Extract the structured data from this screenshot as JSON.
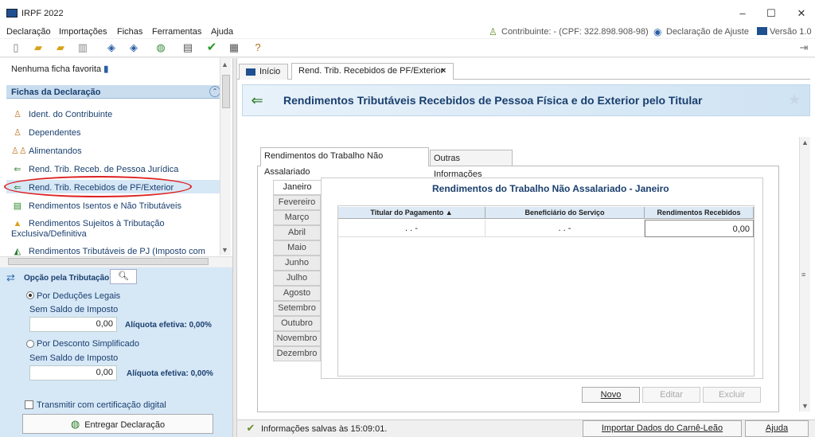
{
  "window": {
    "title": "IRPF 2022"
  },
  "menu": [
    "Declaração",
    "Importações",
    "Fichas",
    "Ferramentas",
    "Ajuda"
  ],
  "status_right": {
    "contribuinte": "Contribuinte: - (CPF: 322.898.908-98)",
    "declaracao": "Declaração de Ajuste",
    "versao": "Versão 1.0"
  },
  "sidebar": {
    "favorites": "Nenhuma ficha favorita",
    "header": "Fichas da Declaração",
    "items": [
      "Ident. do Contribuinte",
      "Dependentes",
      "Alimentandos",
      "Rend. Trib. Receb. de Pessoa Jurídica",
      "Rend. Trib. Recebidos de PF/Exterior",
      "Rendimentos Isentos e Não Tributáveis",
      "Rendimentos Sujeitos à Tributação",
      "Exclusiva/Definitiva",
      "Rendimentos Tributáveis de PJ (Imposto com"
    ]
  },
  "opcao": {
    "title": "Opção pela Tributação:",
    "deducoes_label": "Por Deduções Legais",
    "deducoes_sub": "Sem Saldo de Imposto",
    "deducoes_value": "0,00",
    "deducoes_aliq": "Alíquota efetiva: 0,00%",
    "simplificado_label": "Por Desconto Simplificado",
    "simplificado_sub": "Sem Saldo de Imposto",
    "simplificado_value": "0,00",
    "simplificado_aliq": "Alíquota efetiva: 0,00%",
    "transmitir": "Transmitir com certificação digital",
    "entregar": "Entregar Declaração"
  },
  "tabs": {
    "inicio": "Início",
    "current": "Rend. Trib. Recebidos de PF/Exterior",
    "close": "×"
  },
  "header_title": "Rendimentos Tributáveis Recebidos de Pessoa Física e do Exterior pelo Titular",
  "subtabs": [
    "Rendimentos do Trabalho Não Assalariado",
    "Outras Informações"
  ],
  "months": [
    "Janeiro",
    "Fevereiro",
    "Março",
    "Abril",
    "Maio",
    "Junho",
    "Julho",
    "Agosto",
    "Setembro",
    "Outubro",
    "Novembro",
    "Dezembro"
  ],
  "month_title": "Rendimentos do Trabalho Não Assalariado - Janeiro",
  "grid": {
    "headers": [
      "Titular do Pagamento ▲",
      "Beneficiário do Serviço",
      "Rendimentos Recebidos"
    ],
    "row": [
      ". . -",
      ". . -",
      "0,00"
    ]
  },
  "buttons": {
    "novo": "Novo",
    "editar": "Editar",
    "excluir": "Excluir",
    "importar": "Importar Dados do Carnê-Leão",
    "ajuda": "Ajuda"
  },
  "status_bottom": "Informações salvas às 15:09:01."
}
